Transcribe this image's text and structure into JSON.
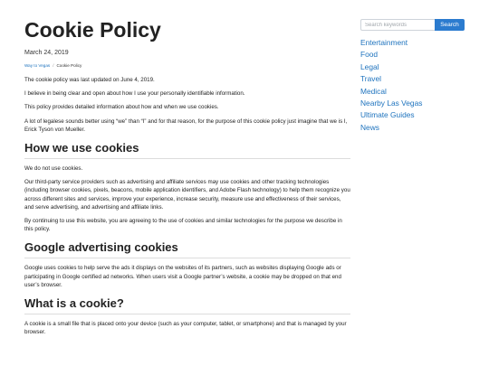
{
  "article": {
    "title": "Cookie Policy",
    "date": "March 24, 2019",
    "breadcrumb": {
      "home": "Way to Vegas",
      "separator": "/",
      "current": "Cookie Policy"
    },
    "intro": [
      "The cookie policy was last updated on June 4, 2019.",
      "I believe in being clear and open about how I use your personally identifiable information.",
      "This policy provides detailed information about how and when we use cookies.",
      "A lot of legalese sounds better using “we” than “I” and for that reason, for the purpose of this cookie policy just imagine that we is I, Erick Tyson von Mueller."
    ],
    "sections": [
      {
        "heading": "How we use cookies",
        "paragraphs": [
          "We do not use cookies.",
          "Our third-party service providers such as advertising and affiliate services may use cookies and other tracking technologies (including browser cookies, pixels, beacons, mobile application identifiers, and Adobe Flash technology) to help them recognize you across different sites and services, improve your experience, increase security, measure use and effectiveness of their services, and serve advertising, and advertising and affiliate links.",
          "By continuing to use this website, you are agreeing to the use of cookies and similar technologies for the purpose we describe in this policy."
        ]
      },
      {
        "heading": "Google advertising cookies",
        "paragraphs": [
          "Google uses cookies to help serve the ads it displays on the websites of its partners, such as websites displaying Google ads or participating in Google certified ad networks. When users visit a Google partner’s website, a cookie may be dropped on that end user’s browser."
        ]
      },
      {
        "heading": "What is a cookie?",
        "paragraphs": [
          "A cookie is a small file that is placed onto your device (such as your computer, tablet, or smartphone) and that is managed by your browser."
        ]
      }
    ]
  },
  "sidebar": {
    "search": {
      "placeholder": "Search keywords",
      "button_label": "Search"
    },
    "categories": [
      "Entertainment",
      "Food",
      "Legal",
      "Travel",
      "Medical",
      "Nearby Las Vegas",
      "Ultimate Guides",
      "News"
    ]
  },
  "colors": {
    "link": "#1e73be",
    "button": "#2b7bcf",
    "heading": "#222222"
  }
}
